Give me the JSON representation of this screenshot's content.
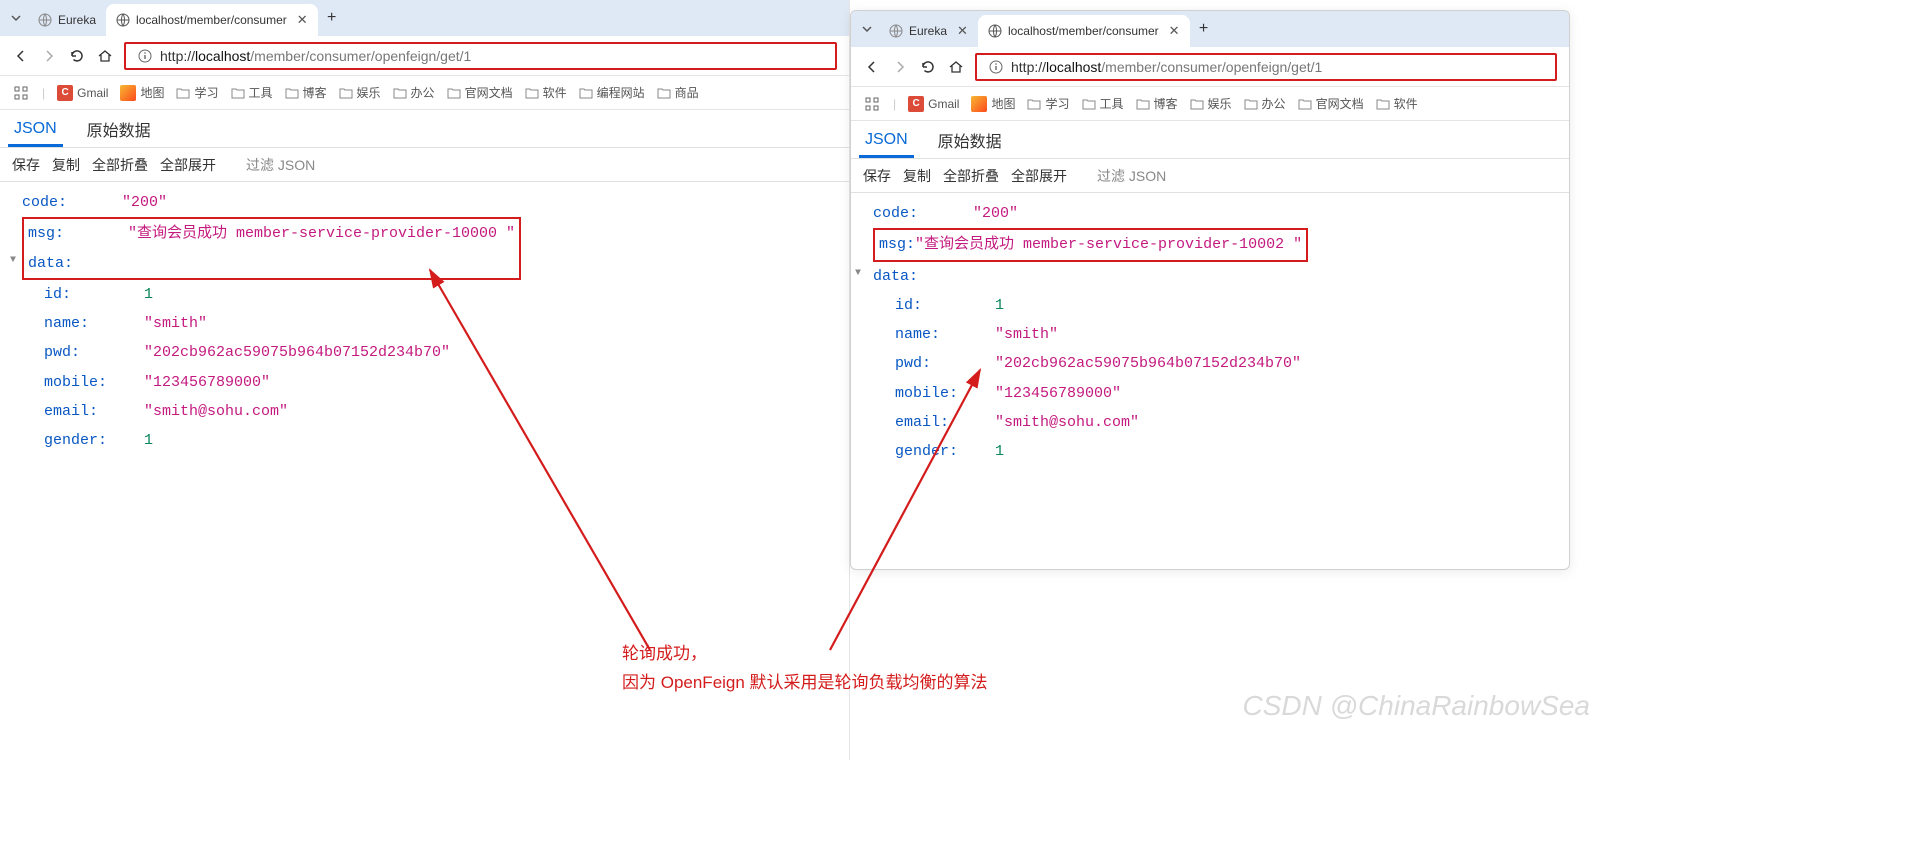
{
  "windows": [
    {
      "id": "left",
      "tabs": [
        {
          "title": "Eureka",
          "active": false,
          "kind": "globe"
        },
        {
          "title": "localhost/member/consumer",
          "active": true,
          "kind": "globe"
        }
      ],
      "url_proto": "http://",
      "url_host": "localhost",
      "url_path": "/member/consumer/openfeign/get/1",
      "json": {
        "code": "\"200\"",
        "msg": "\"查询会员成功 member-service-provider-10000 \"",
        "data_label": "data:",
        "id": "1",
        "name": "\"smith\"",
        "pwd": "\"202cb962ac59075b964b07152d234b70\"",
        "mobile": "\"123456789000\"",
        "email": "\"smith@sohu.com\"",
        "gender": "1"
      }
    },
    {
      "id": "right",
      "tabs": [
        {
          "title": "Eureka",
          "active": false,
          "kind": "globe"
        },
        {
          "title": "localhost/member/consumer",
          "active": true,
          "kind": "globe"
        }
      ],
      "url_proto": "http://",
      "url_host": "localhost",
      "url_path": "/member/consumer/openfeign/get/1",
      "json": {
        "code": "\"200\"",
        "msg": "\"查询会员成功 member-service-provider-10002 \"",
        "data_label": "data:",
        "id": "1",
        "name": "\"smith\"",
        "pwd": "\"202cb962ac59075b964b07152d234b70\"",
        "mobile": "\"123456789000\"",
        "email": "\"smith@sohu.com\"",
        "gender": "1"
      }
    }
  ],
  "bookmarks": [
    {
      "label": "Gmail",
      "kind": "c"
    },
    {
      "label": "地图",
      "kind": "map"
    },
    {
      "label": "学习",
      "kind": "folder"
    },
    {
      "label": "工具",
      "kind": "folder"
    },
    {
      "label": "博客",
      "kind": "folder"
    },
    {
      "label": "娱乐",
      "kind": "folder"
    },
    {
      "label": "办公",
      "kind": "folder"
    },
    {
      "label": "官网文档",
      "kind": "folder"
    },
    {
      "label": "软件",
      "kind": "folder"
    },
    {
      "label": "编程网站",
      "kind": "folder"
    },
    {
      "label": "商品",
      "kind": "folder"
    }
  ],
  "bookmarks_right_max": 8,
  "viewer": {
    "tab_json": "JSON",
    "tab_raw": "原始数据",
    "save": "保存",
    "copy": "复制",
    "collapse": "全部折叠",
    "expand": "全部展开",
    "filter": "过滤 JSON"
  },
  "keys": {
    "code": "code",
    "msg": "msg",
    "data": "data",
    "id": "id",
    "name": "name",
    "pwd": "pwd",
    "mobile": "mobile",
    "email": "email",
    "gender": "gender"
  },
  "caption_line1": "轮询成功，",
  "caption_line2": "因为 OpenFeign 默认采用是轮询负载均衡的算法",
  "watermark": "CSDN @ChinaRainbowSea"
}
